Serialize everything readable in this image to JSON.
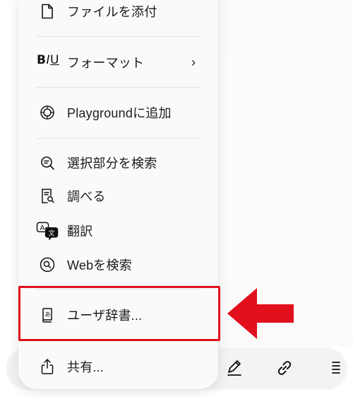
{
  "menu": {
    "items": [
      {
        "label": "ファイルを添付",
        "icon": "document-icon"
      },
      {
        "label": "フォーマット",
        "icon": "biu-format-icon",
        "submenu": true,
        "biu": {
          "b": "B",
          "i": "I",
          "u": "U"
        }
      },
      {
        "label": "Playgroundに追加",
        "icon": "playground-icon"
      },
      {
        "label": "選択部分を検索",
        "icon": "magnifier-lines-icon"
      },
      {
        "label": "調べる",
        "icon": "lookup-icon"
      },
      {
        "label": "翻訳",
        "icon": "translate-icon"
      },
      {
        "label": "Webを検索",
        "icon": "web-search-icon"
      },
      {
        "label": "ユーザ辞書...",
        "icon": "dictionary-icon"
      },
      {
        "label": "共有...",
        "icon": "share-icon"
      }
    ],
    "submenu_indicator": "›"
  },
  "toolbar": {
    "icons": [
      "pen-icon",
      "link-icon",
      "list-icon"
    ]
  },
  "annotation": {
    "highlight_color": "#e20f1c",
    "target_item": "ユーザ辞書..."
  }
}
